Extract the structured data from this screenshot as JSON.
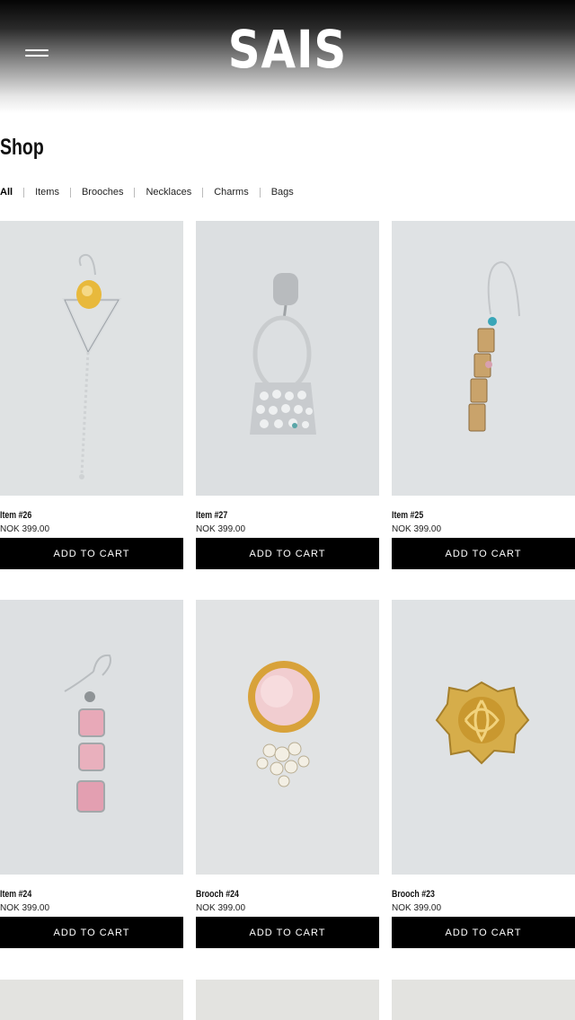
{
  "header": {
    "logo": "SAIS",
    "menu_icon": "hamburger-menu-icon"
  },
  "page": {
    "title": "Shop"
  },
  "filters": [
    {
      "label": "All",
      "active": true
    },
    {
      "label": "Items",
      "active": false
    },
    {
      "label": "Brooches",
      "active": false
    },
    {
      "label": "Necklaces",
      "active": false
    },
    {
      "label": "Charms",
      "active": false
    },
    {
      "label": "Bags",
      "active": false
    }
  ],
  "products": [
    {
      "name": "Item #26",
      "price": "NOK 399.00",
      "button": "ADD TO CART",
      "image": "triangle-chain-earring"
    },
    {
      "name": "Item #27",
      "price": "NOK 399.00",
      "button": "ADD TO CART",
      "image": "handbag-earring"
    },
    {
      "name": "Item #25",
      "price": "NOK 399.00",
      "button": "ADD TO CART",
      "image": "gold-chain-earring"
    },
    {
      "name": "Item #24",
      "price": "NOK 399.00",
      "button": "ADD TO CART",
      "image": "pink-stone-earring"
    },
    {
      "name": "Brooch #24",
      "price": "NOK 399.00",
      "button": "ADD TO CART",
      "image": "pink-ring-pearl-brooch"
    },
    {
      "name": "Brooch #23",
      "price": "NOK 399.00",
      "button": "ADD TO CART",
      "image": "gold-knot-brooch"
    }
  ]
}
